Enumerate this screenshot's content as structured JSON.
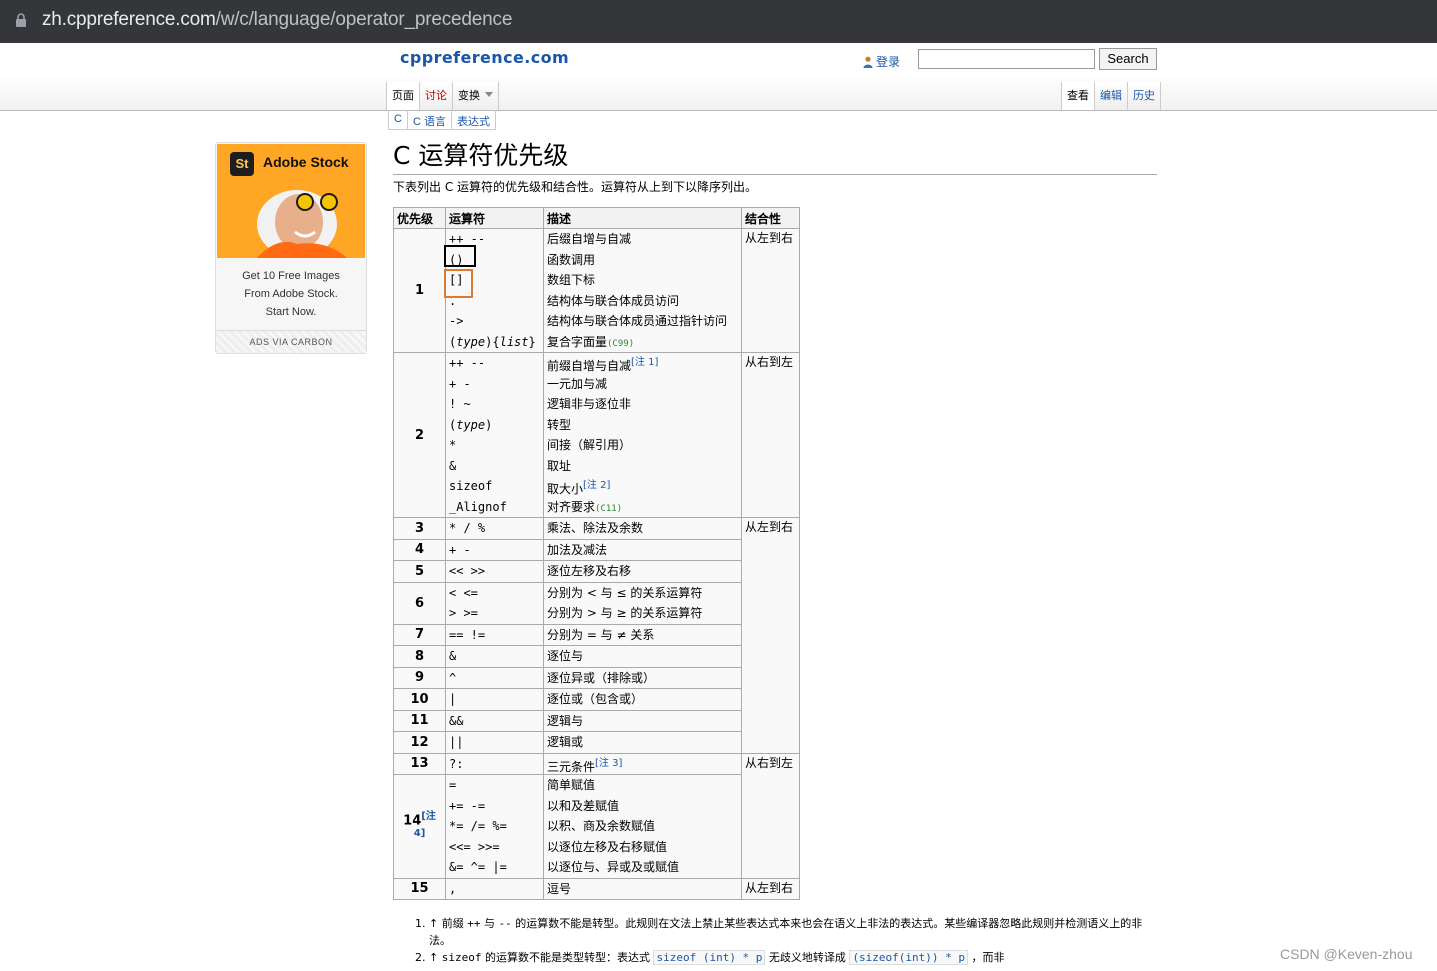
{
  "browser": {
    "url_host": "zh.cppreference.com",
    "url_path": "/w/c/language/operator_precedence"
  },
  "site": {
    "logo": "cppreference.com",
    "login": "登录",
    "search_placeholder": "",
    "search_button": "Search"
  },
  "tabs": {
    "left": [
      "页面",
      "讨论",
      "变换"
    ],
    "right": [
      "查看",
      "编辑",
      "历史"
    ]
  },
  "breadcrumbs": [
    "C",
    "C 语言",
    "表达式"
  ],
  "ad": {
    "brand": "Adobe Stock",
    "badge": "St",
    "lines": [
      "Get 10 Free Images",
      "From Adobe Stock.",
      "Start Now."
    ],
    "via": "ADS VIA CARBON"
  },
  "page": {
    "title": "C 运算符优先级",
    "intro": "下表列出 C 运算符的优先级和结合性。运算符从上到下以降序列出。"
  },
  "table": {
    "headers": [
      "优先级",
      "运算符",
      "描述",
      "结合性"
    ],
    "assoc": [
      "从左到右",
      "从右到左",
      "从左到右",
      "从右到左",
      "从右到左",
      "从左到右"
    ],
    "rows": [
      {
        "level": "1",
        "items": [
          {
            "op": "++ --",
            "desc": "后缀自增与自减"
          },
          {
            "op": "()",
            "desc": "函数调用"
          },
          {
            "op": "[]",
            "desc": "数组下标"
          },
          {
            "op": ".",
            "desc": "结构体与联合体成员访问"
          },
          {
            "op": "->",
            "desc": "结构体与联合体成员通过指针访问"
          },
          {
            "op_a": "(",
            "op_b": "type",
            "op_c": "){",
            "op_d": "list",
            "op_e": "}",
            "desc": "复合字面量",
            "ver": "(C99)"
          }
        ]
      },
      {
        "level": "2",
        "items": [
          {
            "op": "++ --",
            "desc": "前缀自增与自减",
            "note": "[注 1]"
          },
          {
            "op": "+ -",
            "desc": "一元加与减"
          },
          {
            "op": "! ~",
            "desc": "逻辑非与逐位非"
          },
          {
            "op_a": "(",
            "op_b": "type",
            "op_c": ")",
            "desc": "转型"
          },
          {
            "op": "*",
            "desc": "间接（解引用）"
          },
          {
            "op": "&",
            "desc": "取址"
          },
          {
            "op": "sizeof",
            "desc": "取大小",
            "note": "[注 2]"
          },
          {
            "op": "_Alignof",
            "desc": "对齐要求",
            "ver": "(C11)"
          }
        ]
      },
      {
        "level": "3",
        "items": [
          {
            "op": "* / %",
            "desc": "乘法、除法及余数"
          }
        ]
      },
      {
        "level": "4",
        "items": [
          {
            "op": "+ -",
            "desc": "加法及减法"
          }
        ]
      },
      {
        "level": "5",
        "items": [
          {
            "op": "<< >>",
            "desc": "逐位左移及右移"
          }
        ]
      },
      {
        "level": "6",
        "items": [
          {
            "op": "< <=",
            "desc": "分别为 < 与 ≤ 的关系运算符"
          },
          {
            "op": "> >=",
            "desc": "分别为 > 与 ≥ 的关系运算符"
          }
        ]
      },
      {
        "level": "7",
        "items": [
          {
            "op": "== !=",
            "desc": "分别为 = 与 ≠ 关系"
          }
        ]
      },
      {
        "level": "8",
        "items": [
          {
            "op": "&",
            "desc": "逐位与"
          }
        ]
      },
      {
        "level": "9",
        "items": [
          {
            "op": "^",
            "desc": "逐位异或（排除或）"
          }
        ]
      },
      {
        "level": "10",
        "items": [
          {
            "op": "|",
            "desc": "逐位或（包含或）"
          }
        ]
      },
      {
        "level": "11",
        "items": [
          {
            "op": "&&",
            "desc": "逻辑与"
          }
        ]
      },
      {
        "level": "12",
        "items": [
          {
            "op": "||",
            "desc": "逻辑或"
          }
        ]
      },
      {
        "level": "13",
        "items": [
          {
            "op": "?:",
            "desc": "三元条件",
            "note": "[注 3]"
          }
        ]
      },
      {
        "level": "14",
        "level_note": "[注 4]",
        "items": [
          {
            "op": "=",
            "desc": "简单赋值"
          },
          {
            "op": "+= -=",
            "desc": "以和及差赋值"
          },
          {
            "op": "*= /= %=",
            "desc": "以积、商及余数赋值"
          },
          {
            "op": "<<= >>=",
            "desc": "以逐位左移及右移赋值"
          },
          {
            "op": "&= ^= |=",
            "desc": "以逐位与、异或及或赋值"
          }
        ]
      },
      {
        "level": "15",
        "items": [
          {
            "op": ",",
            "desc": "逗号"
          }
        ]
      }
    ]
  },
  "notes": {
    "n1_a": "↑ 前缀 ",
    "n1_op1": "++",
    "n1_b": " 与 ",
    "n1_op2": "--",
    "n1_c": " 的运算数不能是转型。此规则在文法上禁止某些表达式本来也会在语义上非法的表达式。某些编译器忽略此规则并检测语义上的非法。",
    "n2_a": "↑ ",
    "n2_op": "sizeof",
    "n2_b": " 的运算数不能是类型转型：表达式 ",
    "n2_code1": "sizeof (int) * p",
    "n2_c": " 无歧义地转译成 ",
    "n2_code2": "(sizeof(int)) * p",
    "n2_d": " ，而非"
  },
  "watermark": "CSDN @Keven-zhou"
}
